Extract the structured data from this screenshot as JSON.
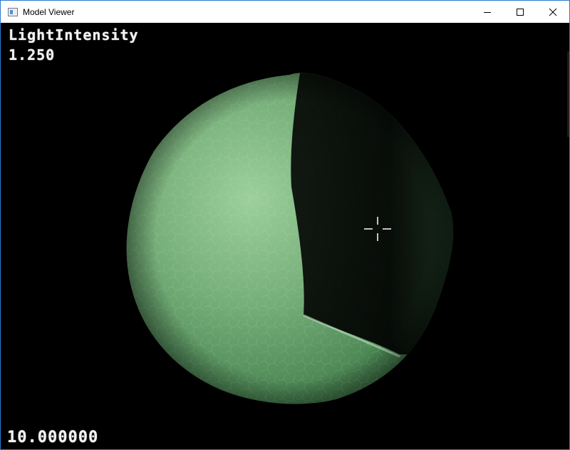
{
  "window": {
    "title": "Model Viewer",
    "icon": "app-window-icon"
  },
  "controls": {
    "minimize_icon": "minimize-icon",
    "maximize_icon": "maximize-icon",
    "close_icon": "close-icon"
  },
  "hud": {
    "parameter_label": "LightIntensity",
    "parameter_value": "1.250",
    "bottom_readout": "10.000000"
  },
  "scene": {
    "model": "textured sphere",
    "base_color": "#6fa873",
    "shadow_color": "#0a120b",
    "background": "#000000",
    "cursor_icon": "crosshair-icon"
  }
}
